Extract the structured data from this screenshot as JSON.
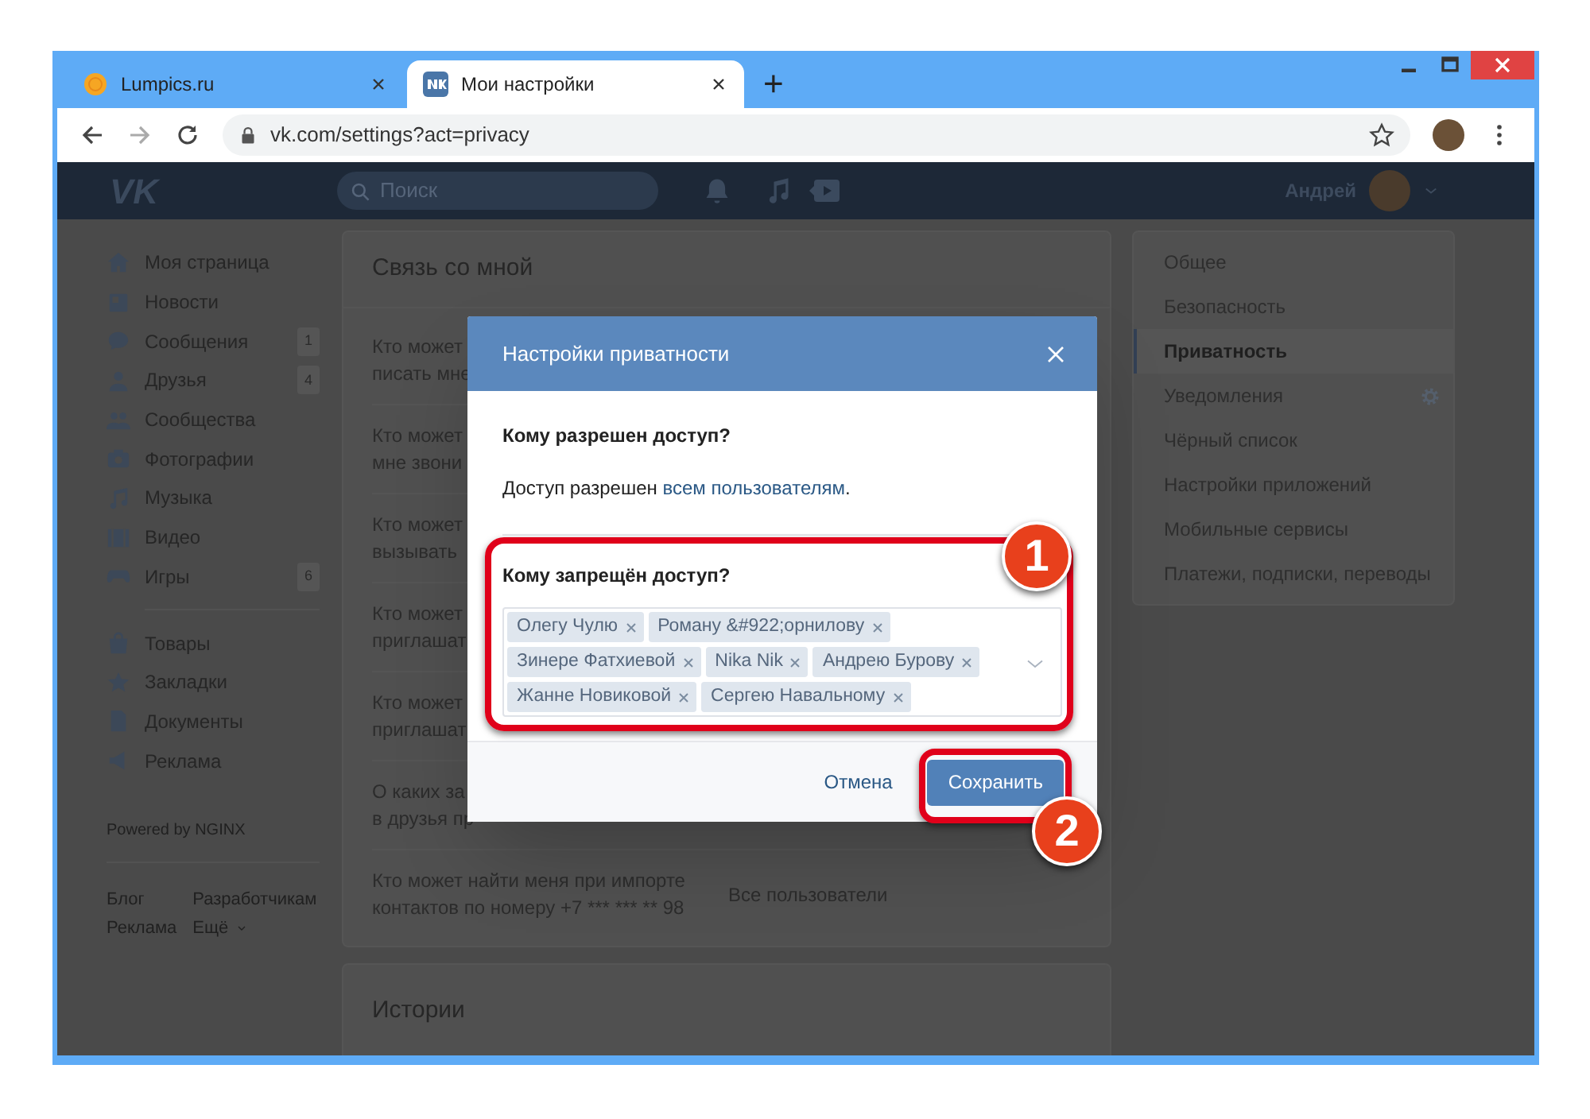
{
  "browser": {
    "tabs": [
      {
        "title": "Lumpics.ru",
        "selected": false
      },
      {
        "title": "Мои настройки",
        "selected": true
      }
    ],
    "new_tab": "+",
    "url": "vk.com/settings?act=privacy"
  },
  "header": {
    "logo": "VK",
    "search": {
      "placeholder": "Поиск"
    },
    "user_name": "Андрей"
  },
  "sidebar": {
    "items": [
      {
        "label": "Моя страница"
      },
      {
        "label": "Новости"
      },
      {
        "label": "Сообщения",
        "count": "1"
      },
      {
        "label": "Друзья",
        "count": "4"
      },
      {
        "label": "Сообщества"
      },
      {
        "label": "Фотографии"
      },
      {
        "label": "Музыка"
      },
      {
        "label": "Видео"
      },
      {
        "label": "Игры",
        "count": "6"
      }
    ],
    "items_2": [
      {
        "label": "Товары"
      },
      {
        "label": "Закладки"
      },
      {
        "label": "Документы"
      },
      {
        "label": "Реклама"
      }
    ],
    "powered": "Powered by NGINX",
    "footer_links": [
      "Блог",
      "Разработчикам",
      "Реклама",
      "Ещё"
    ]
  },
  "settings_card": {
    "title": "Связь со мной",
    "rows": [
      {
        "label": [
          "Кто может",
          "писать мне"
        ]
      },
      {
        "label": [
          "Кто может",
          "мне звони"
        ]
      },
      {
        "label": [
          "Кто может",
          "вызывать"
        ]
      },
      {
        "label": [
          "Кто может",
          "приглашат"
        ]
      },
      {
        "label": [
          "Кто может",
          "приглашат"
        ]
      },
      {
        "label": [
          "О каких за",
          "в друзья пр"
        ]
      },
      {
        "label": [
          "Кто может найти меня при импорте",
          "контактов по номеру +7 *** *** ** 98"
        ],
        "value": "Все пользователи"
      }
    ]
  },
  "stories_card": {
    "title": "Истории"
  },
  "settings_menu": [
    {
      "label": "Общее",
      "selected": false
    },
    {
      "label": "Безопасность",
      "selected": false
    },
    {
      "label": "Приватность",
      "selected": true
    },
    {
      "label": "Уведомления",
      "selected": false,
      "gear": true
    },
    {
      "label": "Чёрный список",
      "selected": false
    },
    {
      "label": "Настройки приложений",
      "selected": false
    },
    {
      "label": "Мобильные сервисы",
      "selected": false
    },
    {
      "label": "Платежи, подписки, переводы",
      "selected": false
    }
  ],
  "dialog": {
    "title": "Настройки приватности",
    "allowed_heading": "Кому разрешен доступ?",
    "allowed_text_before": "Доступ разрешен ",
    "allowed_link": "всем пользователям",
    "allowed_text_after": ".",
    "denied_heading": "Кому запрещён доступ?",
    "denied_users": [
      "Олегу Чулю",
      "Роману &#922;орнилову",
      "Зинере Фатхиевой",
      "Nika Nik",
      "Андрею Бурову",
      "Жанне Новиковой",
      "Сергею Навальному"
    ],
    "cancel": "Отмена",
    "save": "Сохранить"
  },
  "annotations": [
    {
      "label": "1"
    },
    {
      "label": "2"
    }
  ]
}
